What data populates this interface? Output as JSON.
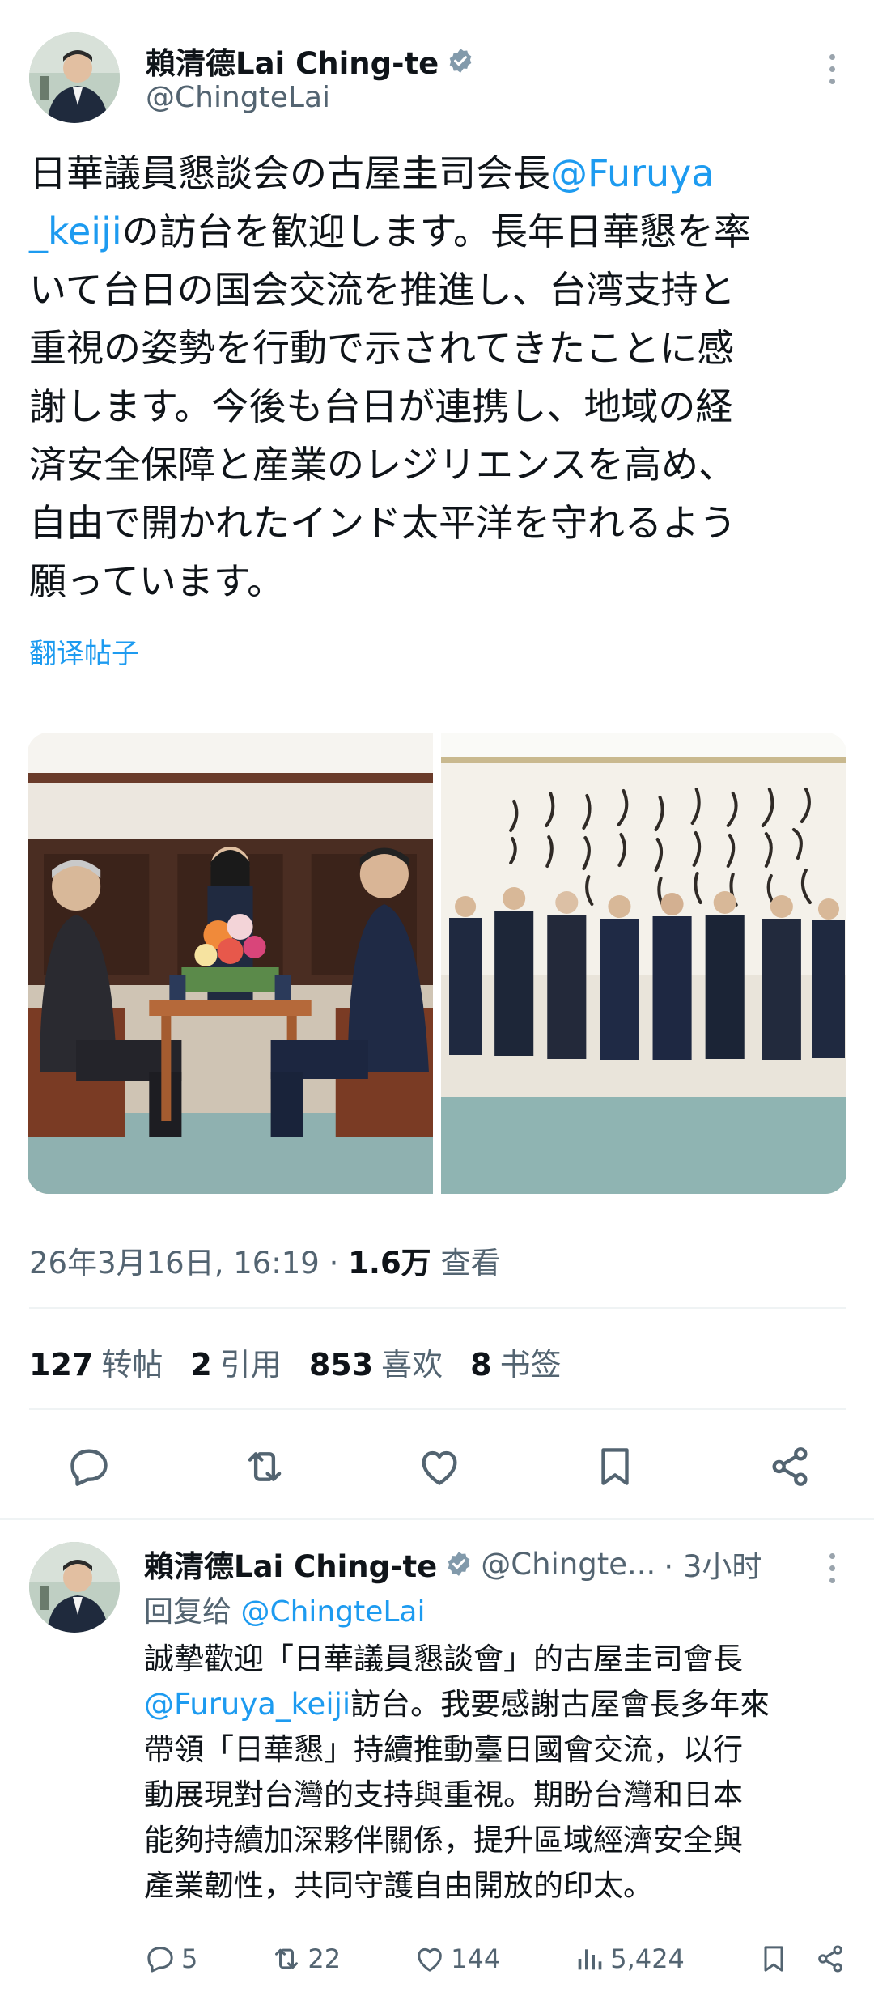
{
  "tweet": {
    "author_name": "賴清德Lai Ching-te",
    "handle": "@ChingteLai",
    "text_lines": [
      {
        "pre": "日華議員懇談会の古屋圭司会長",
        "mention": "@Furuya",
        "post": ""
      },
      {
        "pre": "",
        "mention": "_keiji",
        "post": "の訪台を歓迎します。長年日華懇を率"
      },
      {
        "pre": "いて台日の国会交流を推進し、台湾支持と",
        "mention": "",
        "post": ""
      },
      {
        "pre": "重視の姿勢を行動で示されてきたことに感",
        "mention": "",
        "post": ""
      },
      {
        "pre": "謝します。今後も台日が連携し、地域の経",
        "mention": "",
        "post": ""
      },
      {
        "pre": "済安全保障と産業のレジリエンスを高め、",
        "mention": "",
        "post": ""
      },
      {
        "pre": "自由で開かれたインド太平洋を守れるよう",
        "mention": "",
        "post": ""
      },
      {
        "pre": "願っています。",
        "mention": "",
        "post": ""
      }
    ],
    "translate_label": "翻译帖子",
    "timestamp": "26年3月16日, 16:19 · ",
    "views_count": "1.6万",
    "views_label": " 查看",
    "stats": {
      "reposts_count": "127",
      "reposts_label": "转帖",
      "quotes_count": "2",
      "quotes_label": "引用",
      "likes_count": "853",
      "likes_label": "喜欢",
      "bookmarks_count": "8",
      "bookmarks_label": "书签"
    }
  },
  "reply": {
    "author_name": "賴清德Lai Ching-te",
    "handle": "@Chingte...",
    "time": "· 3小时",
    "reply_to_prefix": "回复给 ",
    "reply_to_handle": "@ChingteLai",
    "text_lines": [
      {
        "pre": "誠摯歡迎「日華議員懇談會」的古屋圭司會長",
        "mention": "",
        "post": ""
      },
      {
        "pre": "",
        "mention": "@Furuya_keiji",
        "post": "訪台。我要感謝古屋會長多年來"
      },
      {
        "pre": "帶領「日華懇」持續推動臺日國會交流，以行",
        "mention": "",
        "post": ""
      },
      {
        "pre": "動展現對台灣的支持與重視。期盼台灣和日本",
        "mention": "",
        "post": ""
      },
      {
        "pre": "能夠持續加深夥伴關係，提升區域經濟安全與",
        "mention": "",
        "post": ""
      },
      {
        "pre": "產業韌性，共同守護自由開放的印太。",
        "mention": "",
        "post": ""
      }
    ],
    "replies": "5",
    "reposts": "22",
    "likes": "144",
    "views": "5,424"
  },
  "colors": {
    "accent": "#1d9bf0",
    "secondary_text": "#536471",
    "divider": "#eff3f4"
  }
}
